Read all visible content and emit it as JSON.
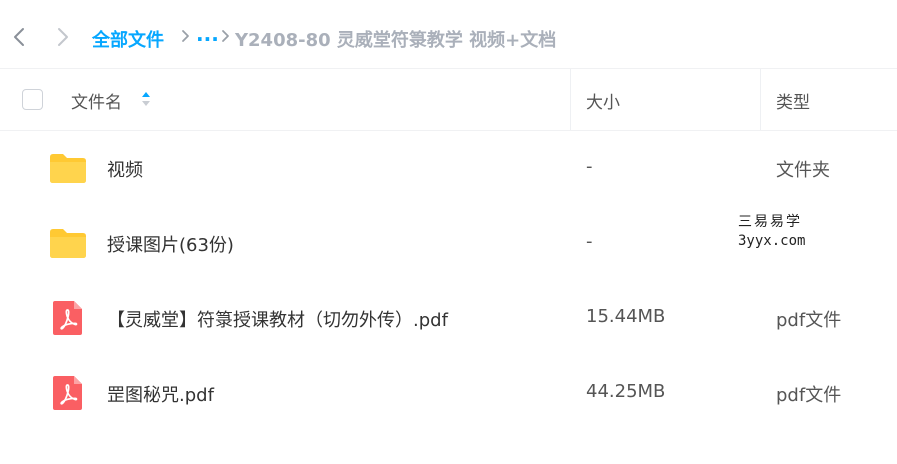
{
  "breadcrumb": {
    "root": "全部文件",
    "ellipsis": "...",
    "current": "Y2408-80 灵威堂符箓教学 视频+文档"
  },
  "columns": {
    "name": "文件名",
    "size": "大小",
    "type": "类型"
  },
  "files": [
    {
      "icon": "folder-icon",
      "name": "视频",
      "size": "-",
      "type": "文件夹"
    },
    {
      "icon": "folder-icon",
      "name": "授课图片(63份)",
      "size": "-",
      "type": ""
    },
    {
      "icon": "pdf-icon",
      "name": "【灵威堂】符箓授课教材（切勿外传）.pdf",
      "size": "15.44MB",
      "type": "pdf文件"
    },
    {
      "icon": "pdf-icon",
      "name": "罡图秘咒.pdf",
      "size": "44.25MB",
      "type": "pdf文件"
    }
  ],
  "watermark": {
    "line1": "三易易学",
    "line2": "3yyx.com"
  },
  "colors": {
    "accent": "#06a7ff",
    "folder": "#ffc933",
    "pdf": "#fa5f63",
    "muted": "#aab0ba"
  }
}
